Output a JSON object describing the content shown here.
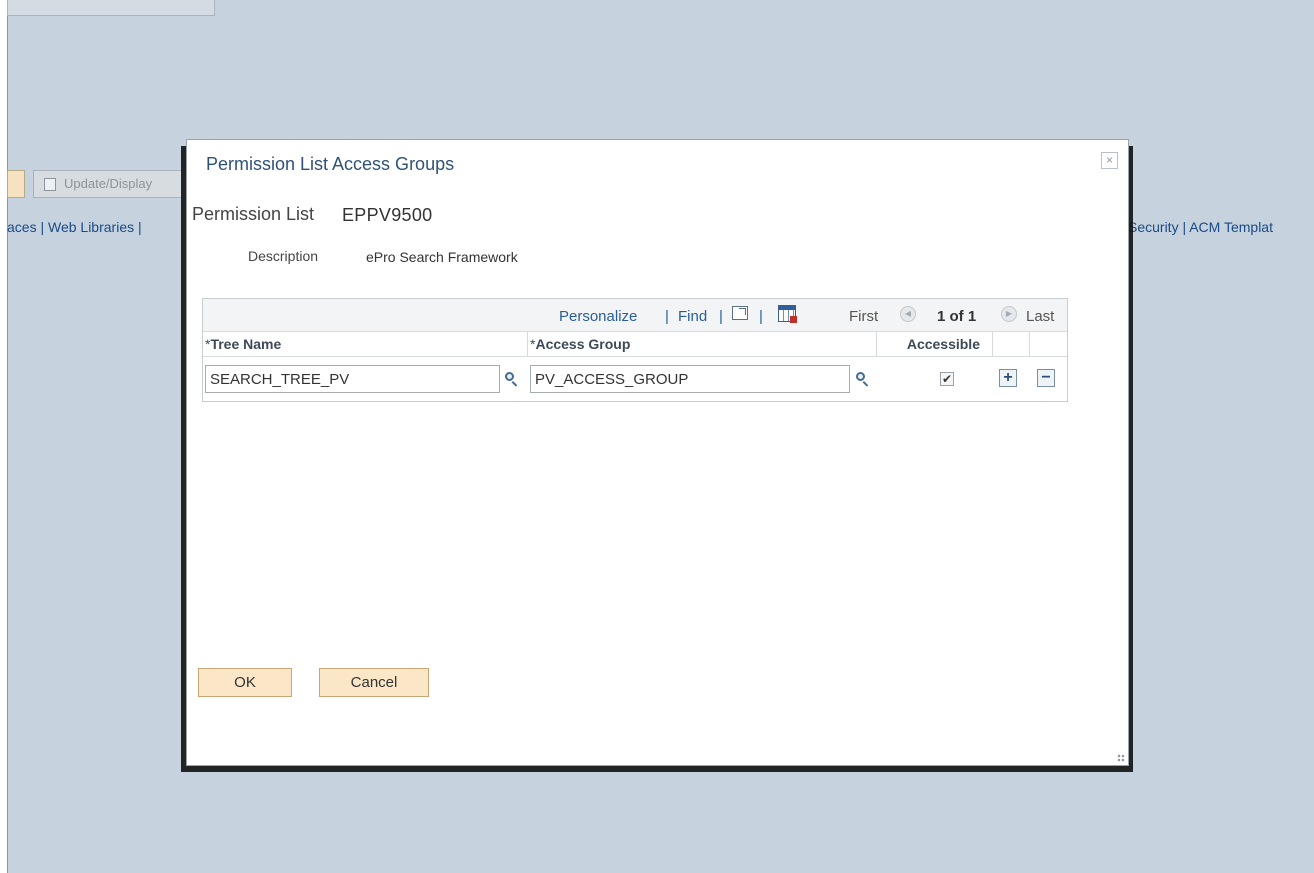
{
  "background": {
    "update_button_label": "Update/Display",
    "links_left": "aces | Web Libraries |",
    "links_right": "Security | ACM Templat"
  },
  "modal": {
    "title": "Permission List Access Groups",
    "close_symbol": "×",
    "permission_list_label": "Permission List",
    "permission_list_value": "EPPV9500",
    "description_label": "Description",
    "description_value": "ePro Search Framework",
    "grid": {
      "nav": {
        "personalize": "Personalize",
        "find": "Find",
        "separator": "|",
        "first": "First",
        "count": "1 of 1",
        "last": "Last"
      },
      "columns": {
        "tree_name": "Tree Name",
        "access_group": "Access Group",
        "accessible": "Accessible",
        "required_marker": "*"
      },
      "rows": [
        {
          "tree_name": "SEARCH_TREE_PV",
          "access_group": "PV_ACCESS_GROUP",
          "accessible": true
        }
      ],
      "add_symbol": "+",
      "delete_symbol": "−"
    },
    "ok_label": "OK",
    "cancel_label": "Cancel"
  },
  "icons": {
    "check_mark": "✔",
    "prev_arrow": "◀",
    "next_arrow": "▶"
  },
  "colors": {
    "background": "#c6d3df",
    "title": "#2f5278",
    "link": "#2a5d97",
    "button": "#fbe6c7"
  }
}
